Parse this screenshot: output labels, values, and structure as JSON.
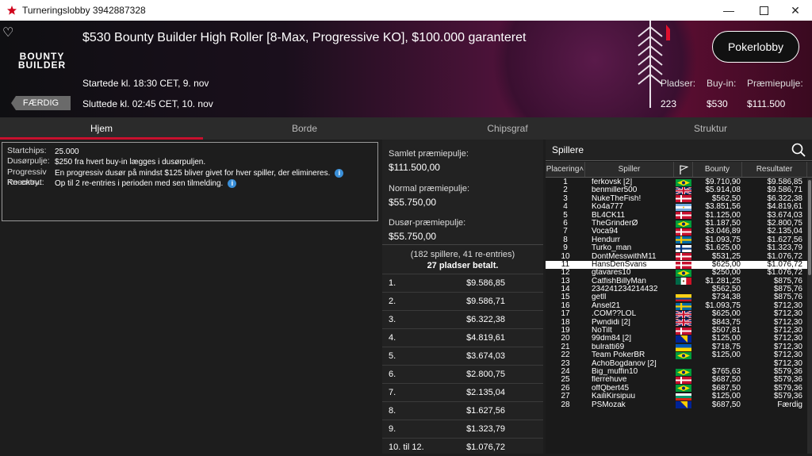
{
  "window": {
    "title": "Turneringslobby 3942887328"
  },
  "banner": {
    "logo_line1": "BOUNTY",
    "logo_line2": "BUILDER",
    "title": "$530 Bounty Builder High Roller [8-Max, Progressive KO], $100.000 garanteret",
    "started": "Startede kl. 18:30 CET, 9. nov",
    "ended": "Sluttede kl. 02:45 CET, 10. nov",
    "status_badge": "FÆRDIG",
    "lobby_button": "Pokerlobby",
    "stats": [
      {
        "label": "Pladser:",
        "value": "223"
      },
      {
        "label": "Buy-in:",
        "value": "$530"
      },
      {
        "label": "Præmiepulje:",
        "value": "$111.500"
      }
    ]
  },
  "tabs": [
    "Hjem",
    "Borde",
    "Chipsgraf",
    "Struktur"
  ],
  "info": {
    "startchips_label": "Startchips:",
    "startchips_value": "25.000",
    "bountypool_label": "Dusørpulje:",
    "bountypool_value": "$250 fra hvert buy-in lægges i dusørpuljen.",
    "pko_label": "Progressiv Knockout:",
    "pko_value": "En progressiv dusør på mindst $125 bliver givet for hver spiller, der elimineres.",
    "reentry_label": "Re-entry:",
    "reentry_value": "Op til 2 re-entries i perioden med sen tilmelding."
  },
  "pool": {
    "total_label": "Samlet præmiepulje:",
    "total_value": "$111.500,00",
    "normal_label": "Normal præmiepulje:",
    "normal_value": "$55.750,00",
    "bounty_label": "Dusør-præmiepulje:",
    "bounty_value": "$55.750,00",
    "note": "(182 spillere, 41 re-entries)",
    "paid": "27 pladser betalt.",
    "prizes": [
      {
        "place": "1.",
        "amount": "$9.586,85"
      },
      {
        "place": "2.",
        "amount": "$9.586,71"
      },
      {
        "place": "3.",
        "amount": "$6.322,38"
      },
      {
        "place": "4.",
        "amount": "$4.819,61"
      },
      {
        "place": "5.",
        "amount": "$3.674,03"
      },
      {
        "place": "6.",
        "amount": "$2.800,75"
      },
      {
        "place": "7.",
        "amount": "$2.135,04"
      },
      {
        "place": "8.",
        "amount": "$1.627,56"
      },
      {
        "place": "9.",
        "amount": "$1.323,79"
      },
      {
        "place": "10. til 12.",
        "amount": "$1.076,72"
      }
    ]
  },
  "players": {
    "header": "Spillere",
    "columns": [
      "Placering",
      "Spiller",
      "",
      "Bounty",
      "Resultater"
    ],
    "rows": [
      {
        "place": "1",
        "name": "ferkovsk [2]",
        "flag": "br",
        "bounty": "$9.710,90",
        "result": "$9.586,85"
      },
      {
        "place": "2",
        "name": "benmiller500",
        "flag": "gb",
        "bounty": "$5.914,08",
        "result": "$9.586,71"
      },
      {
        "place": "3",
        "name": "NukeTheFish!",
        "flag": "dk",
        "bounty": "$562,50",
        "result": "$6.322,38"
      },
      {
        "place": "4",
        "name": "Ko4a777",
        "flag": "ar",
        "bounty": "$3.851,56",
        "result": "$4.819,61"
      },
      {
        "place": "5",
        "name": "BL4CK11",
        "flag": "dk",
        "bounty": "$1.125,00",
        "result": "$3.674,03"
      },
      {
        "place": "6",
        "name": "TheGrinderØ",
        "flag": "br",
        "bounty": "$1.187,50",
        "result": "$2.800,75"
      },
      {
        "place": "7",
        "name": "Voca94",
        "flag": "dk",
        "bounty": "$3.046,89",
        "result": "$2.135,04"
      },
      {
        "place": "8",
        "name": "Hendurr",
        "flag": "se",
        "bounty": "$1.093,75",
        "result": "$1.627,56"
      },
      {
        "place": "9",
        "name": "Turko_man",
        "flag": "fi",
        "bounty": "$1.625,00",
        "result": "$1.323,79"
      },
      {
        "place": "10",
        "name": "DontMesswithM11",
        "flag": "dk",
        "bounty": "$531,25",
        "result": "$1.076,72"
      },
      {
        "place": "11",
        "name": "HansDenSvans",
        "flag": "dk",
        "bounty": "$625,00",
        "result": "$1.076,72",
        "highlight": true
      },
      {
        "place": "12",
        "name": "gtavares10",
        "flag": "br",
        "bounty": "$250,00",
        "result": "$1.076,72"
      },
      {
        "place": "13",
        "name": "CatfishBillyMan",
        "flag": "mx",
        "bounty": "$1.281,25",
        "result": "$875,76"
      },
      {
        "place": "14",
        "name": "234241234214432",
        "flag": "",
        "bounty": "$562,50",
        "result": "$875,76"
      },
      {
        "place": "15",
        "name": "getll",
        "flag": "co",
        "bounty": "$734,38",
        "result": "$875,76"
      },
      {
        "place": "16",
        "name": "Ansel21",
        "flag": "se",
        "bounty": "$1.093,75",
        "result": "$712,30"
      },
      {
        "place": "17",
        "name": ".COM??LOL",
        "flag": "gb",
        "bounty": "$625,00",
        "result": "$712,30"
      },
      {
        "place": "18",
        "name": "Pwndidi [2]",
        "flag": "gb",
        "bounty": "$843,75",
        "result": "$712,30"
      },
      {
        "place": "19",
        "name": "NoTilt",
        "flag": "dk",
        "bounty": "$507,81",
        "result": "$712,30"
      },
      {
        "place": "20",
        "name": "99dm84 [2]",
        "flag": "ba",
        "bounty": "$125,00",
        "result": "$712,30"
      },
      {
        "place": "21",
        "name": "bulratti69",
        "flag": "ua",
        "bounty": "$718,75",
        "result": "$712,30"
      },
      {
        "place": "22",
        "name": "Team PokerBR",
        "flag": "br",
        "bounty": "$125,00",
        "result": "$712,30"
      },
      {
        "place": "23",
        "name": "AchoBogdanov [2]",
        "flag": "",
        "bounty": "",
        "result": "$712,30"
      },
      {
        "place": "24",
        "name": "Big_muffin10",
        "flag": "br",
        "bounty": "$765,63",
        "result": "$579,36"
      },
      {
        "place": "25",
        "name": "flerrehuve",
        "flag": "dk",
        "bounty": "$687,50",
        "result": "$579,36"
      },
      {
        "place": "26",
        "name": "offQbert45",
        "flag": "br",
        "bounty": "$687,50",
        "result": "$579,36"
      },
      {
        "place": "27",
        "name": "KailiKirsipuu",
        "flag": "bg",
        "bounty": "$125,00",
        "result": "$579,36"
      },
      {
        "place": "28",
        "name": "PSMozak",
        "flag": "ba",
        "bounty": "$687,50",
        "result": "Færdig"
      }
    ]
  }
}
